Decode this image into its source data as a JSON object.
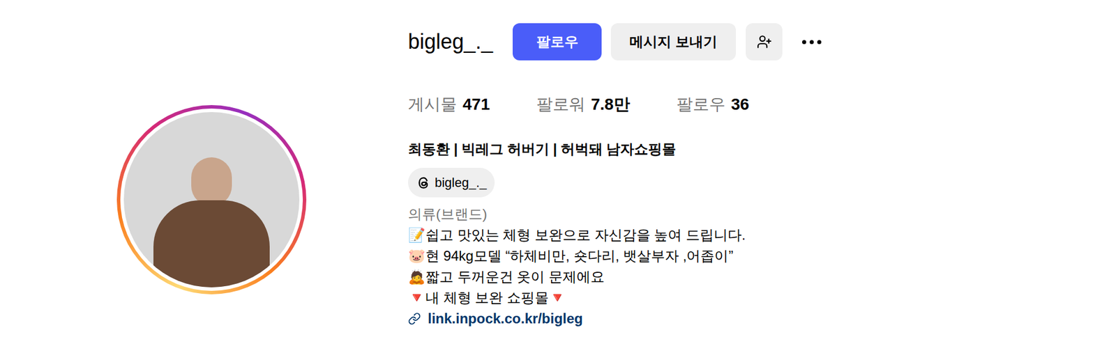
{
  "profile": {
    "username": "bigleg_._",
    "follow_button": "팔로우",
    "message_button": "메시지 보내기"
  },
  "stats": [
    {
      "label": "게시물",
      "value": "471"
    },
    {
      "label": "팔로워",
      "value": "7.8만"
    },
    {
      "label": "팔로우",
      "value": "36"
    }
  ],
  "name": "최동환 | 빅레그 허버기 | 허벅돼 남자쇼핑몰",
  "threads": {
    "handle": "bigleg_._"
  },
  "category": "의류(브랜드)",
  "bio": [
    "📝쉽고 맛있는 체형 보완으로 자신감을 높여 드립니다.",
    "🐷현 94kg모델 “하체비만, 숏다리, 뱃살부자 ,어좁이”",
    "🙇짧고 두꺼운건 옷이 문제에요",
    "🔻내 체형 보완 쇼핑몰🔻"
  ],
  "link": "link.inpock.co.kr/bigleg"
}
